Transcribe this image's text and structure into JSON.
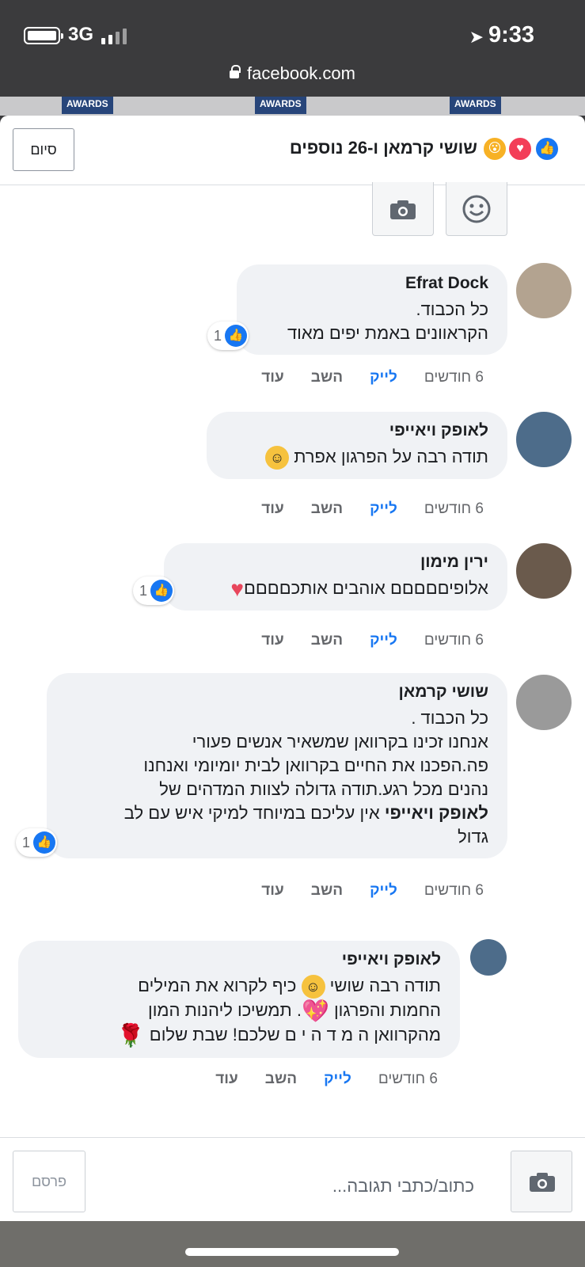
{
  "status_bar": {
    "network": "3G",
    "time": "9:33",
    "url": "facebook.com"
  },
  "background": {
    "awards_label": "AWARDS"
  },
  "header": {
    "done_label": "סיום",
    "reactors_text": "שושי קרמאן ו-26 נוספים"
  },
  "comments": [
    {
      "author": "Efrat Dock",
      "lines": [
        "כל הכבוד.",
        "הקראוונים באמת יפים מאוד"
      ],
      "likes": "1",
      "time": "6 חודשים",
      "like": "לייק",
      "reply": "השב",
      "more": "עוד"
    },
    {
      "author": "לאופק ויאייפי",
      "lines": [
        "תודה רבה על הפרגון אפרת"
      ],
      "time": "6 חודשים",
      "like": "לייק",
      "reply": "השב",
      "more": "עוד"
    },
    {
      "author": "ירין מימון",
      "lines": [
        "אלופיםםםםם אוהבים אותכםםםם"
      ],
      "likes": "1",
      "time": "6 חודשים",
      "like": "לייק",
      "reply": "השב",
      "more": "עוד"
    },
    {
      "author": "שושי קרמאן",
      "lines": [
        "כל הכבוד .",
        "אנחנו זכינו בקרוואן שמשאיר אנשים פעורי",
        "פה.הפכנו את החיים בקרוואן לבית יומיומי ואנחנו",
        "נהנים מכל רגע.תודה גדולה לצוות המדהים של",
        "אין עליכם במיוחד למיקי איש עם לב",
        "גדול"
      ],
      "mention": "לאופק ויאייפי",
      "likes": "1",
      "time": "6 חודשים",
      "like": "לייק",
      "reply": "השב",
      "more": "עוד"
    },
    {
      "author": "לאופק ויאייפי",
      "lines": [
        "תודה רבה שושי",
        "כיף לקרוא את המילים",
        "החמות והפרגון",
        ". תמשיכו ליהנות המון",
        "מהקרוואן ה מ ד ה י ם שלכם! שבת שלום"
      ],
      "time": "6 חודשים",
      "like": "לייק",
      "reply": "השב",
      "more": "עוד"
    }
  ],
  "footer": {
    "post_label": "פרסם",
    "reply_placeholder": "כתוב/כתבי תגובה..."
  }
}
